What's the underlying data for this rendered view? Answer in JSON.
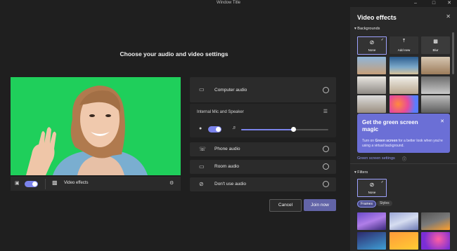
{
  "window": {
    "title": "Window Title",
    "minimize": "–",
    "maximize": "□",
    "close": "✕"
  },
  "main": {
    "heading": "Choose your audio and video settings",
    "video_effects_label": "Video effects",
    "camera_on": true
  },
  "audio": {
    "computer_audio": "Computer audio",
    "device": "Internal Mic and Speaker",
    "mic_on": true,
    "speaker_level": 0.6,
    "phone_audio": "Phone audio",
    "room_audio": "Room audio",
    "dont_use_audio": "Don't use audio"
  },
  "actions": {
    "cancel": "Cancel",
    "join": "Join now"
  },
  "panel": {
    "title": "Video effects",
    "backgrounds_label": "Backgrounds",
    "none_label": "None",
    "add_new_label": "Add new",
    "blur_label": "Blur",
    "green_card": {
      "title": "Get the green screen magic",
      "body_pre": "Turn on ",
      "body_bold": "Green screen",
      "body_post": " for a better look when you're using a virtual background."
    },
    "green_settings": "Green screen settings",
    "filters_label": "Filters",
    "filter_none": "None",
    "filter_tabs": [
      "Frames",
      "Styles"
    ]
  },
  "colors": {
    "accent": "#6264a7",
    "green_screen": "#1fcf5b",
    "toggle": "#7b83eb"
  }
}
